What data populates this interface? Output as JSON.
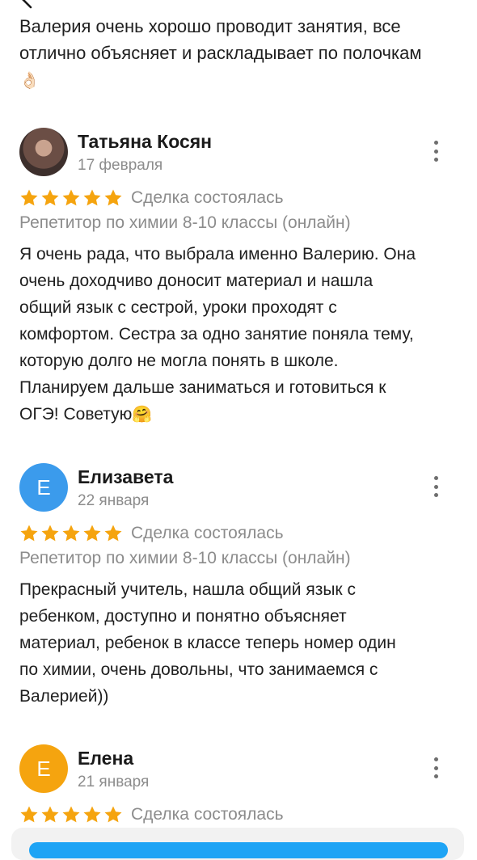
{
  "top_text": {
    "line1": "Валерия очень хорошо проводит занятия, все",
    "line2": "отлично объясняет и раскладывает по полочкам",
    "emoji": "👌🏻"
  },
  "reviews": [
    {
      "name": "Татьяна Косян",
      "date": "17 февраля",
      "avatar_letter": "",
      "rating": 5,
      "deal": "Сделка состоялась",
      "service": "Репетитор по химии 8-10 классы (онлайн)",
      "body": [
        "Я очень рада, что выбрала именно Валерию. Она",
        "очень доходчиво доносит материал и нашла",
        "общий язык с сестрой, уроки проходят с",
        "комфортом. Сестра за одно занятие поняла тему,",
        "которую долго не могла понять в школе.",
        "Планируем дальше заниматься и готовиться к",
        "ОГЭ! Советую"
      ],
      "body_emoji": "🤗"
    },
    {
      "name": "Елизавета",
      "date": "22 января",
      "avatar_letter": "Е",
      "rating": 5,
      "deal": "Сделка состоялась",
      "service": "Репетитор по химии 8-10 классы (онлайн)",
      "body": [
        "Прекрасный учитель, нашла общий язык с",
        "ребенком, доступно и понятно объясняет",
        "материал, ребенок в классе теперь номер один",
        "по химии, очень довольны, что занимаемся с",
        "Валерией))"
      ]
    },
    {
      "name": "Елена",
      "date": "21 января",
      "avatar_letter": "Е",
      "rating": 5,
      "deal": "Сделка состоялась"
    }
  ],
  "colors": {
    "star": "#f5a40f",
    "avatar_blue": "#3b9bec",
    "avatar_orange": "#f5a40f",
    "muted_text": "#8c8c8c",
    "primary_button": "#1ea4f5"
  },
  "icons": [
    "back-arrow-icon",
    "avatar-photo",
    "star-icon",
    "more-vertical-icon"
  ]
}
